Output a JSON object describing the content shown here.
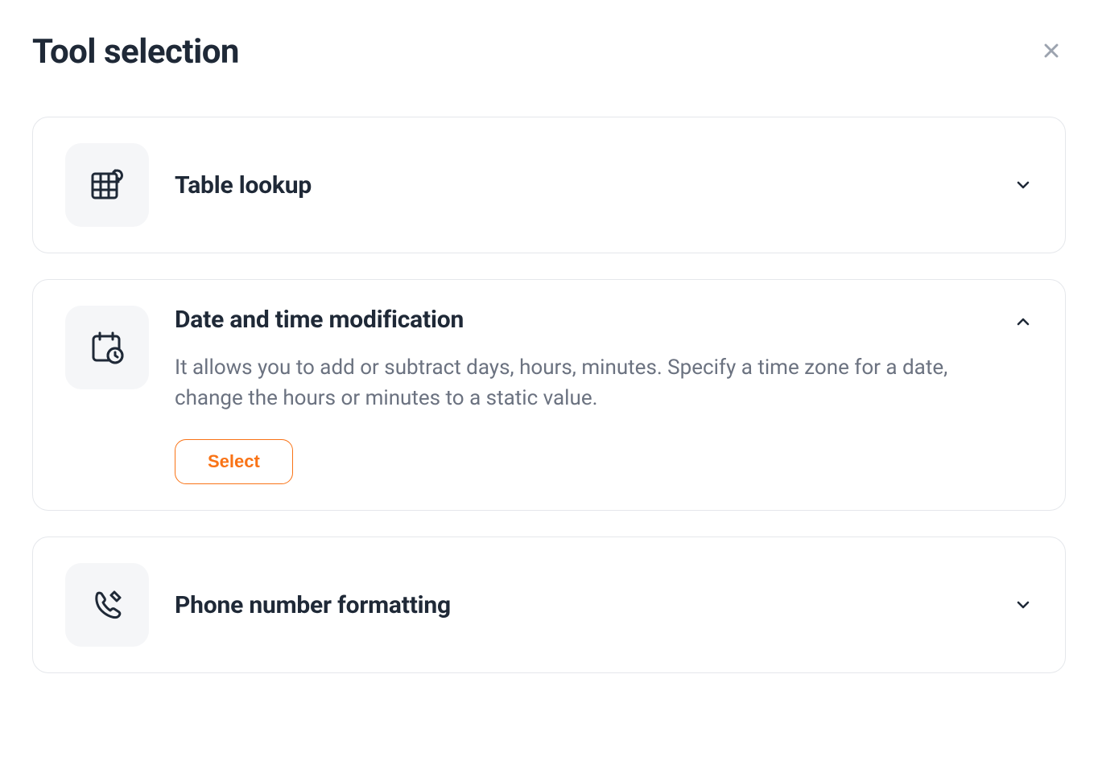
{
  "header": {
    "title": "Tool selection"
  },
  "tools": [
    {
      "title": "Table lookup",
      "expanded": false
    },
    {
      "title": "Date and time modification",
      "description": "It allows you to add or subtract days, hours, minutes. Specify a time zone for a date, change the hours or minutes to a static value.",
      "select_label": "Select",
      "expanded": true
    },
    {
      "title": "Phone number formatting",
      "expanded": false
    }
  ]
}
